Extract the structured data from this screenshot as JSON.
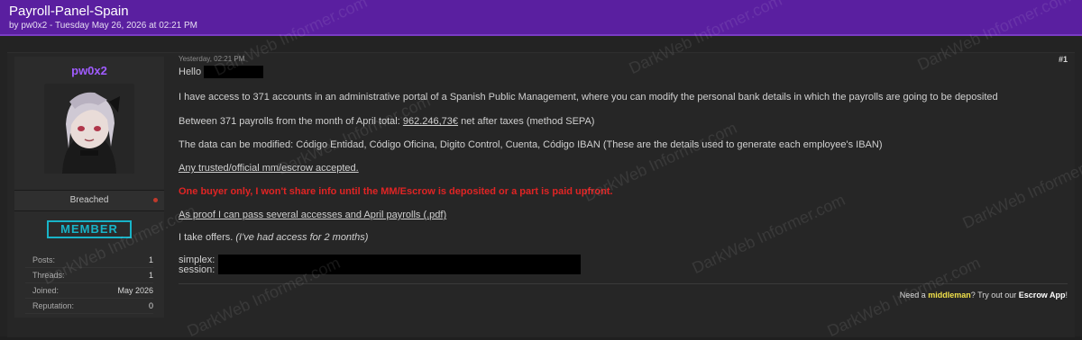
{
  "thread": {
    "title": "Payroll-Panel-Spain",
    "meta": "by pw0x2 - Tuesday May 26, 2026 at 02:21 PM"
  },
  "user": {
    "name": "pw0x2",
    "status": "Breached",
    "rank": "MEMBER",
    "stats": [
      {
        "label": "Posts:",
        "value": "1"
      },
      {
        "label": "Threads:",
        "value": "1"
      },
      {
        "label": "Joined:",
        "value": "May 2026"
      },
      {
        "label": "Reputation:",
        "value": "0"
      }
    ]
  },
  "post": {
    "date": "Yesterday, 02:21 PM",
    "number": "#1",
    "greeting": "Hello",
    "p1": "I have access to 371 accounts in an administrative portal of a Spanish Public Management, where you can modify the personal bank details in which the payrolls are going to be deposited",
    "p2_a": "Between 371 payrolls from the month of April total: ",
    "p2_amount": "962.246,73€",
    "p2_b": " net after taxes (method SEPA)",
    "p3": "The data can be modified: Código Entidad, Código Oficina, Digito Control, Cuenta, Código IBAN (These are the details used to generate each employee's IBAN)",
    "p4": "Any trusted/official mm/escrow accepted.",
    "p5": "One buyer only, I won't share info until the MM/Escrow is deposited or a part is paid upfront.",
    "p6": "As proof I can pass several accesses and April payrolls (.pdf)",
    "p7_a": "I take offers. ",
    "p7_b": "(I've had access for 2 months)",
    "contact1": "simplex:",
    "contact2": "session:"
  },
  "promo": {
    "a": "Need a ",
    "b": "middleman",
    "c": "? Try out our ",
    "d": "Escrow App",
    "e": "!"
  },
  "watermark": "DarkWeb Informer.com"
}
